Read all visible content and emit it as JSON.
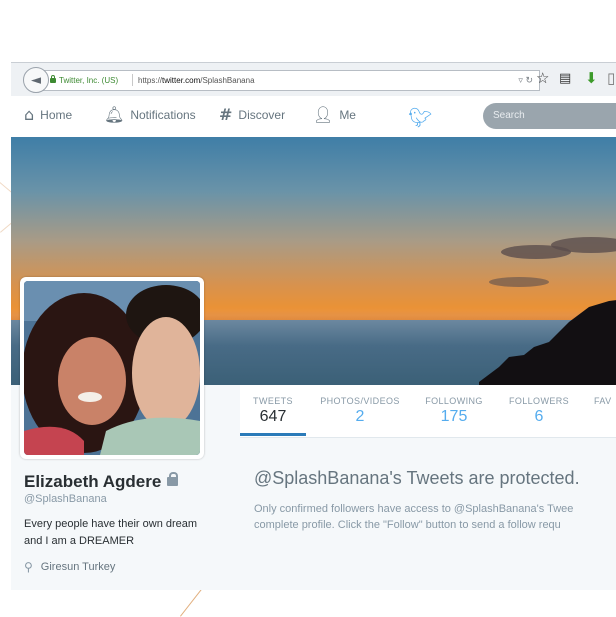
{
  "browser": {
    "ssl_label": "Twitter, Inc. (US)",
    "url_prefix": "https://",
    "url_domain": "twitter.com",
    "url_path": "/SplashBanana"
  },
  "nav": {
    "home": "Home",
    "notifications": "Notifications",
    "discover": "Discover",
    "me": "Me",
    "search_placeholder": "Search"
  },
  "profile": {
    "name": "Elizabeth Agdere",
    "handle": "@SplashBanana",
    "bio": "Every people have their own dream and I am a DREAMER",
    "location": "Giresun Turkey"
  },
  "stats": [
    {
      "label": "TWEETS",
      "value": "647"
    },
    {
      "label": "PHOTOS/VIDEOS",
      "value": "2"
    },
    {
      "label": "FOLLOWING",
      "value": "175"
    },
    {
      "label": "FOLLOWERS",
      "value": "6"
    },
    {
      "label": "FAV",
      "value": ""
    }
  ],
  "protected": {
    "title": "@SplashBanana's Tweets are protected.",
    "line1": "Only confirmed followers have access to @SplashBanana's Twee",
    "line2": "complete profile. Click the \"Follow\" button to send a follow requ"
  },
  "colors": {
    "twitter_blue": "#55acee",
    "ssl_green": "#3d8a32",
    "underline_blue": "#2b7bb9"
  }
}
